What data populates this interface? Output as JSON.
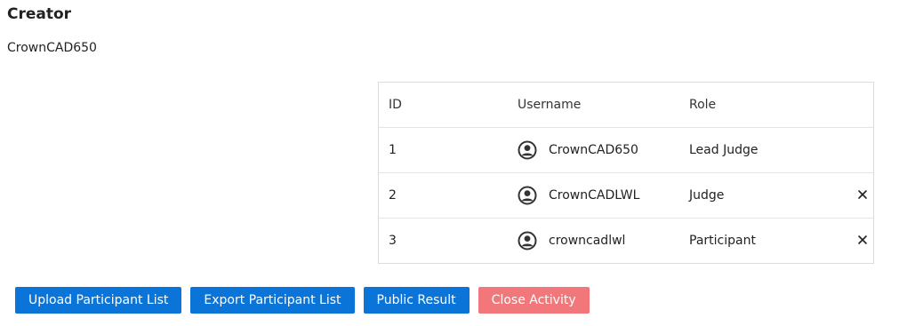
{
  "creator": {
    "heading": "Creator",
    "name": "CrownCAD650"
  },
  "table": {
    "headers": {
      "id": "ID",
      "username": "Username",
      "role": "Role"
    },
    "rows": [
      {
        "id": "1",
        "username": "CrownCAD650",
        "role": "Lead Judge",
        "removable": false
      },
      {
        "id": "2",
        "username": "CrownCADLWL",
        "role": "Judge",
        "removable": true
      },
      {
        "id": "3",
        "username": "crowncadlwl",
        "role": "Participant",
        "removable": true
      }
    ]
  },
  "actions": {
    "upload": "Upload Participant List",
    "export": "Export Participant List",
    "public_result": "Public Result",
    "close_activity": "Close Activity"
  },
  "colors": {
    "primary": "#0a74d9",
    "danger": "#f2777a",
    "border": "#dcdcdc"
  },
  "icons": {
    "user": "user-circle-icon",
    "remove": "close-icon"
  }
}
